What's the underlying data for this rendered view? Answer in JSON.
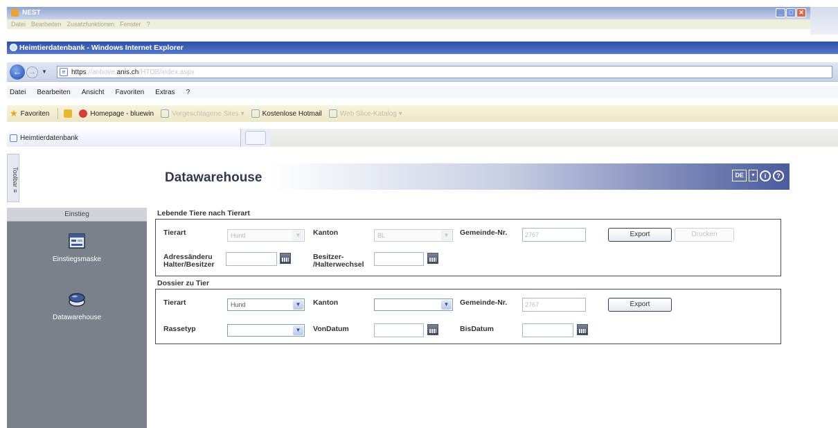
{
  "outer_window": {
    "title": "NEST",
    "menu": [
      "Datei",
      "Bearbeiten",
      "Zusatzfunktionen",
      "Fenster",
      "?"
    ],
    "buttons": [
      "_",
      "□",
      "✕"
    ]
  },
  "browser": {
    "title": "Heimtierdatenbank - Windows Internet Explorer",
    "address": {
      "prefix": "https",
      "host_faint": "://anbove.",
      "host": "anis.ch",
      "path_faint": "/HTDB/index.aspx"
    },
    "menu": [
      "Datei",
      "Bearbeiten",
      "Ansicht",
      "Favoriten",
      "Extras",
      "?"
    ],
    "favorites": {
      "label": "Favoriten",
      "items": [
        {
          "label": "Homepage - bluewin",
          "faint": false
        },
        {
          "label": "Vorgeschlagene Sites ▾",
          "faint": true
        },
        {
          "label": "Kostenlose Hotmail",
          "faint": false
        },
        {
          "label": "Web Slice-Katalog ▾",
          "faint": true
        }
      ]
    },
    "tab": {
      "label": "Heimtierdatenbank"
    }
  },
  "toolbar_tab": {
    "label": "Toolbar ≡"
  },
  "sidebar": {
    "header": "Einstieg",
    "items": [
      {
        "label": "Einstiegsmaske",
        "icon": "form-icon"
      },
      {
        "label": "Datawarehouse",
        "icon": "database-icon"
      }
    ]
  },
  "page": {
    "title": "Datawarehouse",
    "lang": "DE",
    "lang_dropdown": "▾",
    "info_icon": "i",
    "help_icon": "?"
  },
  "section1": {
    "title": "Lebende Tiere nach Tierart",
    "tierart_label": "Tierart",
    "tierart_value": "Hund",
    "kanton_label": "Kanton",
    "kanton_value": "BL",
    "gemeinde_label": "Gemeinde-Nr.",
    "gemeinde_value": "2767",
    "export_label": "Export",
    "drucken_label": "Drucken",
    "adressaenderung_label_1": "Adressänderu",
    "adressaenderung_label_2": "Halter/Besitzer",
    "besitzer_label_1": "Besitzer-",
    "besitzer_label_2": "/Halterwechsel"
  },
  "section2": {
    "title": "Dossier zu Tier",
    "tierart_label": "Tierart",
    "tierart_value": "Hund",
    "kanton_label": "Kanton",
    "kanton_value": "",
    "gemeinde_label": "Gemeinde-Nr.",
    "gemeinde_value": "2767",
    "export_label": "Export",
    "rassetyp_label": "Rassetyp",
    "rassetyp_value": "",
    "vondatum_label": "VonDatum",
    "bisdatum_label": "BisDatum"
  }
}
